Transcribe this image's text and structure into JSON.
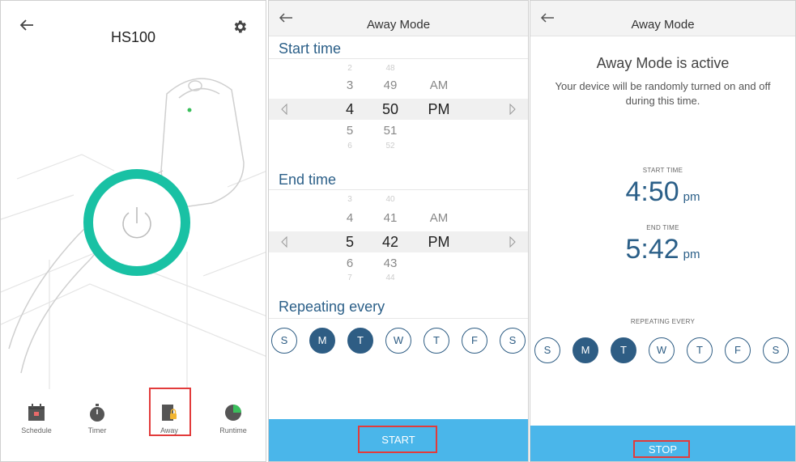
{
  "device_panel": {
    "title": "HS100",
    "tabs": [
      {
        "label": "Schedule",
        "icon": "calendar-icon"
      },
      {
        "label": "Timer",
        "icon": "stopwatch-icon"
      },
      {
        "label": "Away",
        "icon": "away-lock-icon"
      },
      {
        "label": "Runtime",
        "icon": "pie-chart-icon"
      }
    ],
    "power_color": "#19c1a4"
  },
  "setup_panel": {
    "title": "Away Mode",
    "start_label": "Start time",
    "start_picker": {
      "rows": [
        {
          "h": "2",
          "m": "48",
          "ap": ""
        },
        {
          "h": "3",
          "m": "49",
          "ap": "AM"
        },
        {
          "h": "4",
          "m": "50",
          "ap": "PM"
        },
        {
          "h": "5",
          "m": "51",
          "ap": ""
        },
        {
          "h": "6",
          "m": "52",
          "ap": ""
        }
      ]
    },
    "end_label": "End time",
    "end_picker": {
      "rows": [
        {
          "h": "3",
          "m": "40",
          "ap": ""
        },
        {
          "h": "4",
          "m": "41",
          "ap": "AM"
        },
        {
          "h": "5",
          "m": "42",
          "ap": "PM"
        },
        {
          "h": "6",
          "m": "43",
          "ap": ""
        },
        {
          "h": "7",
          "m": "44",
          "ap": ""
        }
      ]
    },
    "repeat_label": "Repeating every",
    "days": [
      {
        "label": "S",
        "on": false
      },
      {
        "label": "M",
        "on": true
      },
      {
        "label": "T",
        "on": true
      },
      {
        "label": "W",
        "on": false
      },
      {
        "label": "T",
        "on": false
      },
      {
        "label": "F",
        "on": false
      },
      {
        "label": "S",
        "on": false
      }
    ],
    "start_button": "START"
  },
  "active_panel": {
    "title": "Away Mode",
    "heading": "Away Mode is active",
    "description": "Your device will be randomly turned on and off during this time.",
    "start_caption": "START TIME",
    "start_time": "4:50",
    "start_ampm": "pm",
    "end_caption": "END TIME",
    "end_time": "5:42",
    "end_ampm": "pm",
    "repeat_caption": "REPEATING EVERY",
    "days": [
      {
        "label": "S",
        "on": false
      },
      {
        "label": "M",
        "on": true
      },
      {
        "label": "T",
        "on": true
      },
      {
        "label": "W",
        "on": false
      },
      {
        "label": "T",
        "on": false
      },
      {
        "label": "F",
        "on": false
      },
      {
        "label": "S",
        "on": false
      }
    ],
    "stop_button": "STOP"
  },
  "colors": {
    "accent_blue": "#4ab6ea",
    "dark_blue": "#2e5d84",
    "highlight_red": "#e23b3b"
  }
}
